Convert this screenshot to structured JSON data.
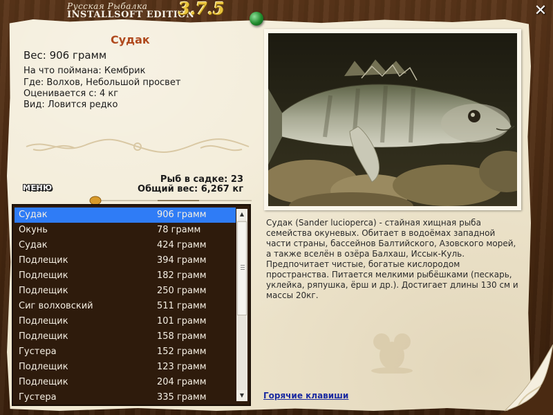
{
  "app": {
    "title_top": "Русская Рыбалка",
    "title_bottom": "INSTALLSOFT EDITION",
    "version": "3.7.5"
  },
  "fish": {
    "name": "Судак",
    "weight": "Вес: 906 грамм",
    "bait": "На что поймана: Кембрик",
    "location": "Где: Волхов, Небольшой просвет",
    "value": "Оценивается с: 4 кг",
    "rarity": "Вид: Ловится редко"
  },
  "summary": {
    "fish_count": "Рыб в садке: 23",
    "total_weight": "Общий вес: 6,267 кг"
  },
  "menu_label": "МЕНЮ",
  "description": "Судак (Sander lucioperca) - стайная хищная рыба семейства окуневых. Обитает в водоёмах западной части страны, бассейнов Балтийского, Азовского морей, а также вселён в озёра Балхаш, Иссык-Куль. Предпочитает чистые, богатые кислородом пространства. Питается мелкими рыбёшками (пескарь, уклейка, ряпушка, ёрш и др.). Достигает длины 130 см и массы 20кг.",
  "hotkeys_label": "Горячие клавиши",
  "catch_list": [
    {
      "name": "Судак",
      "weight": "906 грамм",
      "selected": true
    },
    {
      "name": "Окунь",
      "weight": "78 грамм"
    },
    {
      "name": "Судак",
      "weight": "424 грамм"
    },
    {
      "name": "Подлещик",
      "weight": "394 грамм"
    },
    {
      "name": "Подлещик",
      "weight": "182 грамм"
    },
    {
      "name": "Подлещик",
      "weight": "250 грамм"
    },
    {
      "name": "Сиг волховский",
      "weight": "511 грамм"
    },
    {
      "name": "Подлещик",
      "weight": "101 грамм"
    },
    {
      "name": "Подлещик",
      "weight": "158 грамм"
    },
    {
      "name": "Густера",
      "weight": "152 грамм"
    },
    {
      "name": "Подлещик",
      "weight": "123 грамм"
    },
    {
      "name": "Подлещик",
      "weight": "204 грамм"
    },
    {
      "name": "Густера",
      "weight": "335 грамм"
    }
  ],
  "icons": {
    "close": "close-icon",
    "pin": "pin-icon",
    "float": "float-icon",
    "mouse": "mouse-icon",
    "scroll_up": "scroll-up-icon",
    "scroll_down": "scroll-down-icon"
  },
  "colors": {
    "selected_row": "#2f7cf6",
    "fish_name": "#b04a1e",
    "version": "#e8c23a",
    "link": "#1a2aa0"
  }
}
